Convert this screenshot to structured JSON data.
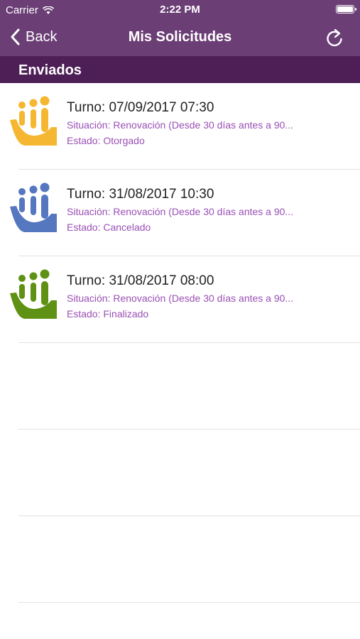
{
  "status_bar": {
    "carrier": "Carrier",
    "time": "2:22 PM"
  },
  "nav": {
    "back_label": "Back",
    "title": "Mis Solicitudes"
  },
  "section": {
    "title": "Enviados"
  },
  "colors": {
    "nav_bg": "#6b3e75",
    "section_bg": "#4e1f57",
    "accent_text": "#9a4fb5"
  },
  "items": [
    {
      "turno": "Turno: 07/09/2017 07:30",
      "situacion": "Situación: Renovación (Desde 30 días antes a 90...",
      "estado": "Estado: Otorgado",
      "logo_color": "#f5b731"
    },
    {
      "turno": "Turno: 31/08/2017 10:30",
      "situacion": "Situación: Renovación (Desde 30 días antes a 90...",
      "estado": "Estado: Cancelado",
      "logo_color": "#5577c0"
    },
    {
      "turno": "Turno: 31/08/2017 08:00",
      "situacion": "Situación: Renovación (Desde 30 días antes a 90...",
      "estado": "Estado: Finalizado",
      "logo_color": "#5f9214"
    }
  ]
}
